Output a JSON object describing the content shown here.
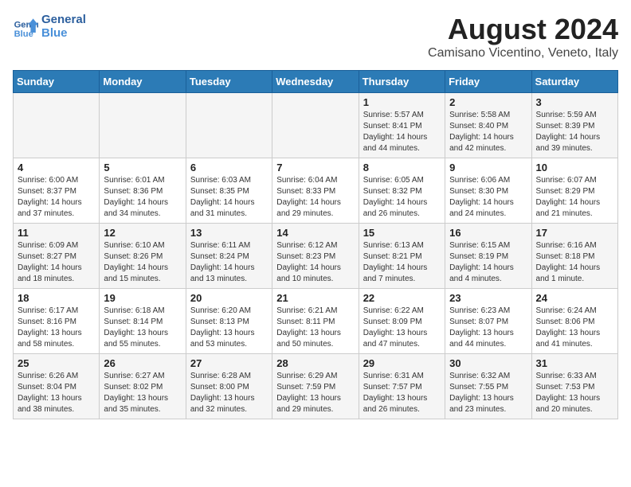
{
  "header": {
    "logo_line1": "General",
    "logo_line2": "Blue",
    "main_title": "August 2024",
    "subtitle": "Camisano Vicentino, Veneto, Italy"
  },
  "weekdays": [
    "Sunday",
    "Monday",
    "Tuesday",
    "Wednesday",
    "Thursday",
    "Friday",
    "Saturday"
  ],
  "weeks": [
    [
      {
        "day": "",
        "info": ""
      },
      {
        "day": "",
        "info": ""
      },
      {
        "day": "",
        "info": ""
      },
      {
        "day": "",
        "info": ""
      },
      {
        "day": "1",
        "info": "Sunrise: 5:57 AM\nSunset: 8:41 PM\nDaylight: 14 hours and 44 minutes."
      },
      {
        "day": "2",
        "info": "Sunrise: 5:58 AM\nSunset: 8:40 PM\nDaylight: 14 hours and 42 minutes."
      },
      {
        "day": "3",
        "info": "Sunrise: 5:59 AM\nSunset: 8:39 PM\nDaylight: 14 hours and 39 minutes."
      }
    ],
    [
      {
        "day": "4",
        "info": "Sunrise: 6:00 AM\nSunset: 8:37 PM\nDaylight: 14 hours and 37 minutes."
      },
      {
        "day": "5",
        "info": "Sunrise: 6:01 AM\nSunset: 8:36 PM\nDaylight: 14 hours and 34 minutes."
      },
      {
        "day": "6",
        "info": "Sunrise: 6:03 AM\nSunset: 8:35 PM\nDaylight: 14 hours and 31 minutes."
      },
      {
        "day": "7",
        "info": "Sunrise: 6:04 AM\nSunset: 8:33 PM\nDaylight: 14 hours and 29 minutes."
      },
      {
        "day": "8",
        "info": "Sunrise: 6:05 AM\nSunset: 8:32 PM\nDaylight: 14 hours and 26 minutes."
      },
      {
        "day": "9",
        "info": "Sunrise: 6:06 AM\nSunset: 8:30 PM\nDaylight: 14 hours and 24 minutes."
      },
      {
        "day": "10",
        "info": "Sunrise: 6:07 AM\nSunset: 8:29 PM\nDaylight: 14 hours and 21 minutes."
      }
    ],
    [
      {
        "day": "11",
        "info": "Sunrise: 6:09 AM\nSunset: 8:27 PM\nDaylight: 14 hours and 18 minutes."
      },
      {
        "day": "12",
        "info": "Sunrise: 6:10 AM\nSunset: 8:26 PM\nDaylight: 14 hours and 15 minutes."
      },
      {
        "day": "13",
        "info": "Sunrise: 6:11 AM\nSunset: 8:24 PM\nDaylight: 14 hours and 13 minutes."
      },
      {
        "day": "14",
        "info": "Sunrise: 6:12 AM\nSunset: 8:23 PM\nDaylight: 14 hours and 10 minutes."
      },
      {
        "day": "15",
        "info": "Sunrise: 6:13 AM\nSunset: 8:21 PM\nDaylight: 14 hours and 7 minutes."
      },
      {
        "day": "16",
        "info": "Sunrise: 6:15 AM\nSunset: 8:19 PM\nDaylight: 14 hours and 4 minutes."
      },
      {
        "day": "17",
        "info": "Sunrise: 6:16 AM\nSunset: 8:18 PM\nDaylight: 14 hours and 1 minute."
      }
    ],
    [
      {
        "day": "18",
        "info": "Sunrise: 6:17 AM\nSunset: 8:16 PM\nDaylight: 13 hours and 58 minutes."
      },
      {
        "day": "19",
        "info": "Sunrise: 6:18 AM\nSunset: 8:14 PM\nDaylight: 13 hours and 55 minutes."
      },
      {
        "day": "20",
        "info": "Sunrise: 6:20 AM\nSunset: 8:13 PM\nDaylight: 13 hours and 53 minutes."
      },
      {
        "day": "21",
        "info": "Sunrise: 6:21 AM\nSunset: 8:11 PM\nDaylight: 13 hours and 50 minutes."
      },
      {
        "day": "22",
        "info": "Sunrise: 6:22 AM\nSunset: 8:09 PM\nDaylight: 13 hours and 47 minutes."
      },
      {
        "day": "23",
        "info": "Sunrise: 6:23 AM\nSunset: 8:07 PM\nDaylight: 13 hours and 44 minutes."
      },
      {
        "day": "24",
        "info": "Sunrise: 6:24 AM\nSunset: 8:06 PM\nDaylight: 13 hours and 41 minutes."
      }
    ],
    [
      {
        "day": "25",
        "info": "Sunrise: 6:26 AM\nSunset: 8:04 PM\nDaylight: 13 hours and 38 minutes."
      },
      {
        "day": "26",
        "info": "Sunrise: 6:27 AM\nSunset: 8:02 PM\nDaylight: 13 hours and 35 minutes."
      },
      {
        "day": "27",
        "info": "Sunrise: 6:28 AM\nSunset: 8:00 PM\nDaylight: 13 hours and 32 minutes."
      },
      {
        "day": "28",
        "info": "Sunrise: 6:29 AM\nSunset: 7:59 PM\nDaylight: 13 hours and 29 minutes."
      },
      {
        "day": "29",
        "info": "Sunrise: 6:31 AM\nSunset: 7:57 PM\nDaylight: 13 hours and 26 minutes."
      },
      {
        "day": "30",
        "info": "Sunrise: 6:32 AM\nSunset: 7:55 PM\nDaylight: 13 hours and 23 minutes."
      },
      {
        "day": "31",
        "info": "Sunrise: 6:33 AM\nSunset: 7:53 PM\nDaylight: 13 hours and 20 minutes."
      }
    ]
  ]
}
